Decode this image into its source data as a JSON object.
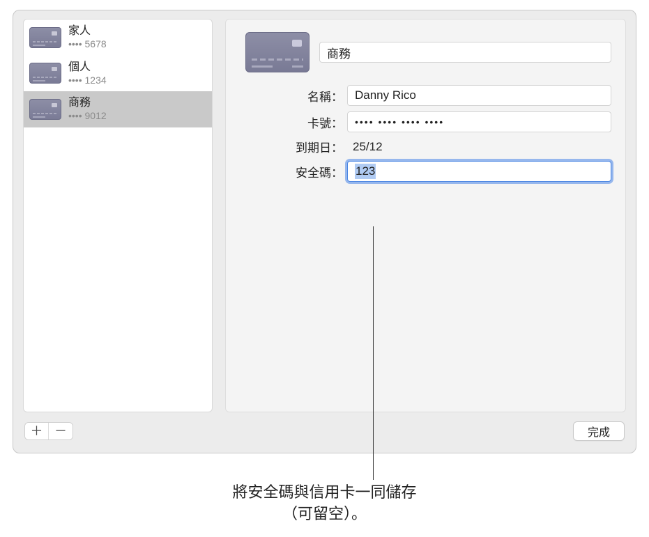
{
  "sidebar": {
    "items": [
      {
        "title": "家人",
        "sub": "•••• 5678"
      },
      {
        "title": "個人",
        "sub": "•••• 1234"
      },
      {
        "title": "商務",
        "sub": "•••• 9012"
      }
    ]
  },
  "detail": {
    "title_value": "商務",
    "labels": {
      "name": "名稱",
      "number": "卡號",
      "expiry": "到期日",
      "cvv": "安全碼"
    },
    "name_value": "Danny Rico",
    "number_value": "•••• •••• •••• ••••",
    "expiry_value": "25/12",
    "cvv_value": "123"
  },
  "footer": {
    "done_label": "完成"
  },
  "callout": {
    "line1": "將安全碼與信用卡一同儲存",
    "line2": "（可留空）。"
  }
}
